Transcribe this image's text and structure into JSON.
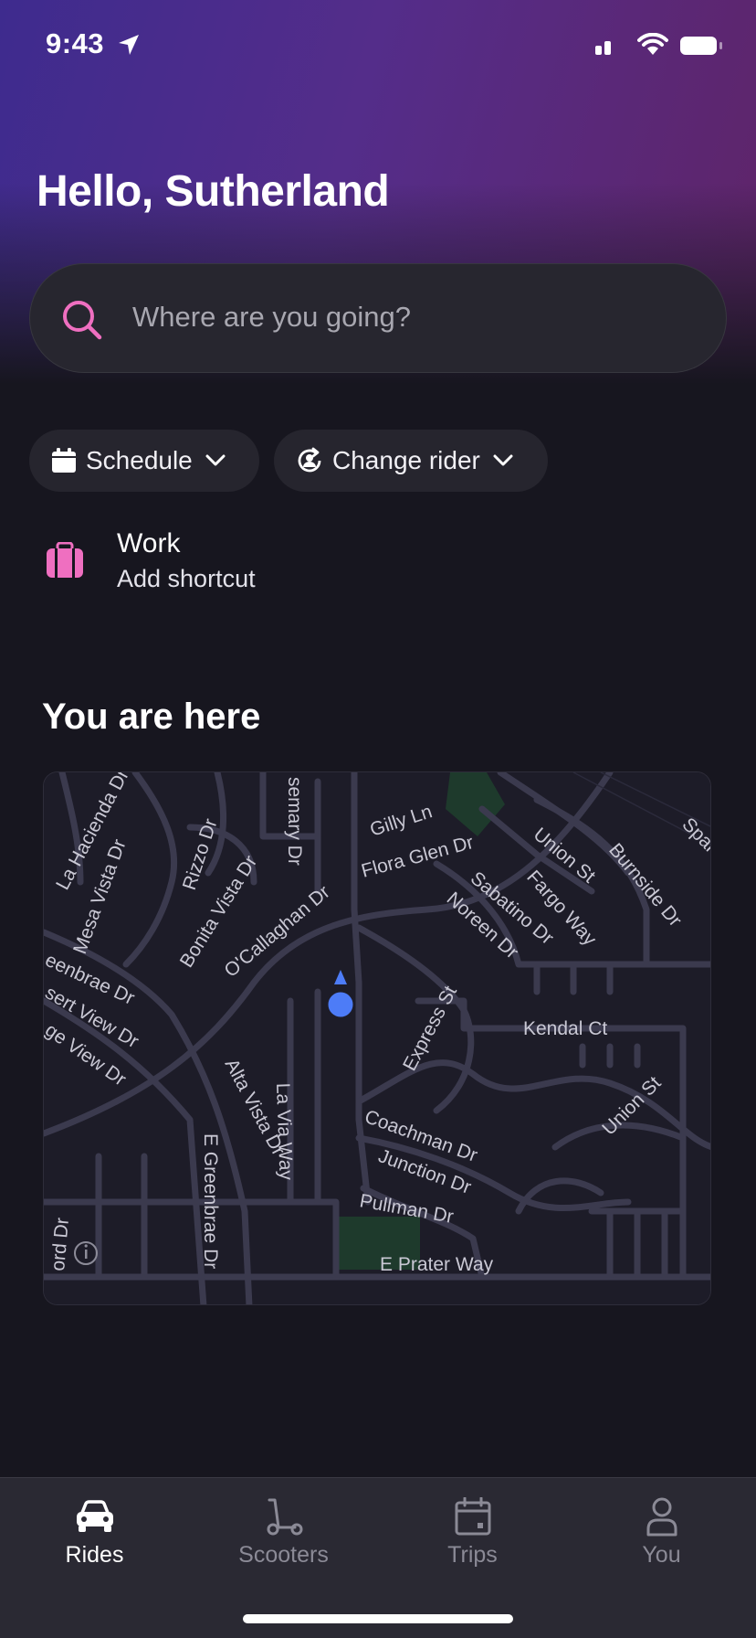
{
  "status_bar": {
    "time": "9:43"
  },
  "header": {
    "greeting": "Hello, Sutherland"
  },
  "search": {
    "placeholder": "Where are you going?"
  },
  "chips": {
    "schedule": "Schedule",
    "change_rider": "Change rider"
  },
  "shortcut": {
    "title": "Work",
    "subtitle": "Add shortcut"
  },
  "map_section": {
    "title": "You are here",
    "streets": {
      "la_hacienda": "La Hacienda Dr",
      "mesa_vista": "Mesa Vista Dr",
      "rizzo": "Rizzo Dr",
      "bonita_vista": "Bonita Vista Dr",
      "rosemary": "semary Dr",
      "gilly": "Gilly Ln",
      "flora_glen": "Flora Glen Dr",
      "union_st_top": "Union St",
      "burnside": "Burnside Dr",
      "spar": "Spar",
      "fargo": "Fargo Way",
      "sabatino": "Sabatino Dr",
      "noreen": "Noreen Dr",
      "ocallaghan": "O'Callaghan Dr",
      "greenbrae": "eenbrae Dr",
      "desert_view": "sert View Dr",
      "ridge_view": "ge View Dr",
      "alta_vista": "Alta Vista Dr",
      "la_via": "La Via Way",
      "express": "Express St",
      "kendal": "Kendal Ct",
      "coachman": "Coachman Dr",
      "union_st_bottom": "Union St",
      "junction": "Junction Dr",
      "e_greenbrae": "E Greenbrae Dr",
      "pullman": "Pullman Dr",
      "e_prater": "E Prater Way",
      "ord": "ord Dr"
    }
  },
  "tabs": [
    {
      "label": "Rides",
      "active": true
    },
    {
      "label": "Scooters",
      "active": false
    },
    {
      "label": "Trips",
      "active": false
    },
    {
      "label": "You",
      "active": false
    }
  ],
  "colors": {
    "accent_pink": "#ef6fc0",
    "location_blue": "#4d7cf7",
    "park_green": "#1e3a2c"
  }
}
